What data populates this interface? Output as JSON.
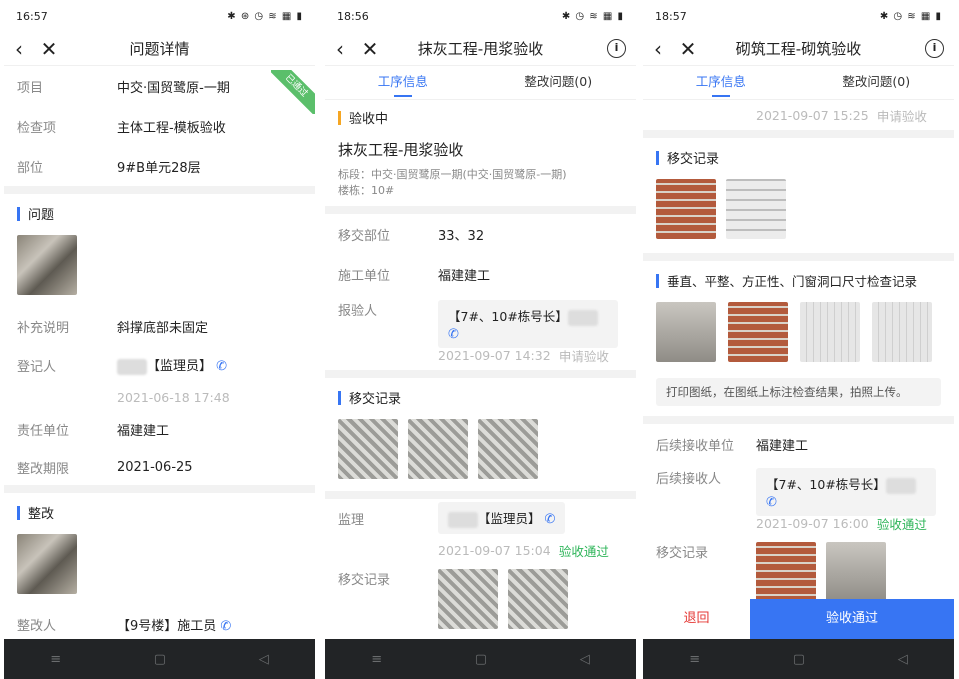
{
  "s1": {
    "status_time": "16:57",
    "status_icons": "✱ ⊛ ◷ ≋ ▦ ▮",
    "title": "问题详情",
    "stamp": "已通过",
    "fields": [
      {
        "label": "项目",
        "value": "中交·国贸鹭原-一期"
      },
      {
        "label": "检查项",
        "value": "主体工程-模板验收"
      },
      {
        "label": "部位",
        "value": "9#B单元28层"
      }
    ],
    "problem_title": "问题",
    "supp_label": "补充说明",
    "supp_value": "斜撑底部未固定",
    "reg_label": "登记人",
    "reg_role": "【监理员】",
    "reg_time": "2021-06-18 17:48",
    "resp_label": "责任单位",
    "resp_value": "福建建工",
    "deadline_label": "整改期限",
    "deadline_value": "2021-06-25",
    "fix_title": "整改",
    "fixer_label": "整改人",
    "fixer_value": "【9号楼】施工员"
  },
  "s2": {
    "status_time": "18:56",
    "status_icons": "✱ ◷ ≋ ▦ ▮",
    "title": "抹灰工程-甩浆验收",
    "tab1": "工序信息",
    "tab2": "整改问题(0)",
    "state": "验收中",
    "heading": "抹灰工程-甩浆验收",
    "sub1": "标段：中交·国贸鹭原一期(中交·国贸鹭原-一期)",
    "sub2": "楼栋：10#",
    "fields": [
      {
        "label": "移交部位",
        "value": "33、32"
      },
      {
        "label": "施工单位",
        "value": "福建建工"
      }
    ],
    "reporter_label": "报验人",
    "reporter_value": "【7#、10#栋号长】",
    "report_time": "2021-09-07 14:32",
    "report_action": "申请验收",
    "transfer_title": "移交记录",
    "supervisor_label": "监理",
    "supervisor_value": "【监理员】",
    "sup_time": "2021-09-07 15:04",
    "sup_action": "验收通过",
    "record_label": "移交记录"
  },
  "s3": {
    "status_time": "18:57",
    "status_icons": "✱ ◷ ≋ ▦ ▮",
    "title": "砌筑工程-砌筑验收",
    "tab1": "工序信息",
    "tab2": "整改问题(0)",
    "top_time": "2021-09-07 15:25",
    "top_action": "申请验收",
    "transfer_title": "移交记录",
    "check_title": "垂直、平整、方正性、门窗洞口尺寸检查记录",
    "note": "打印图纸，在图纸上标注检查结果，拍照上传。",
    "next_unit_label": "后续接收单位",
    "next_unit_value": "福建建工",
    "next_person_label": "后续接收人",
    "next_person_value": "【7#、10#栋号长】",
    "acc_time": "2021-09-07 16:00",
    "acc_action": "验收通过",
    "record_label": "移交记录",
    "btn_return": "退回",
    "btn_pass": "验收通过"
  },
  "nav_icons": {
    "menu": "≡",
    "home": "▢",
    "back": "◁"
  }
}
